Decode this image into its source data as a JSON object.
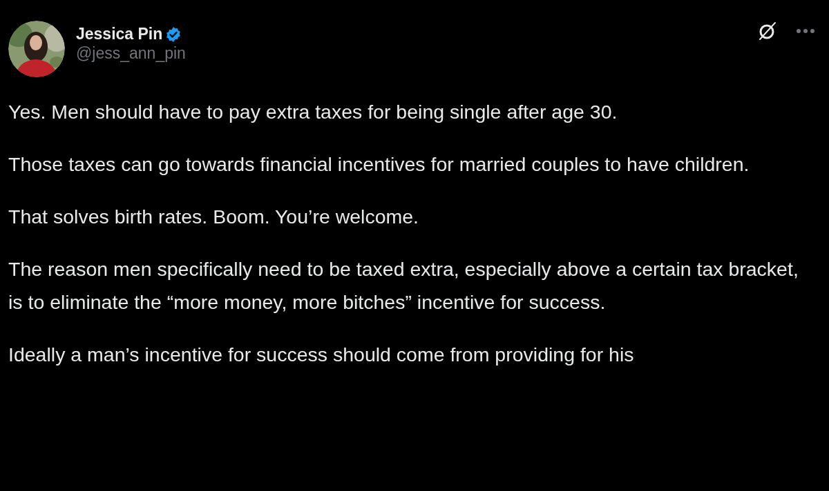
{
  "author": {
    "name": "Jessica Pin",
    "verified": true,
    "handle": "@jess_ann_pin"
  },
  "paragraphs": [
    "Yes. Men should have to pay extra taxes for being single after age 30.",
    "Those taxes can go towards financial incentives for married couples to have children.",
    "That solves birth rates. Boom. You’re welcome.",
    "The reason men specifically need to be taxed extra, especially above a certain tax bracket, is to eliminate the “more money, more bitches” incentive for success.",
    "Ideally a man’s incentive for success should come from providing for his"
  ]
}
